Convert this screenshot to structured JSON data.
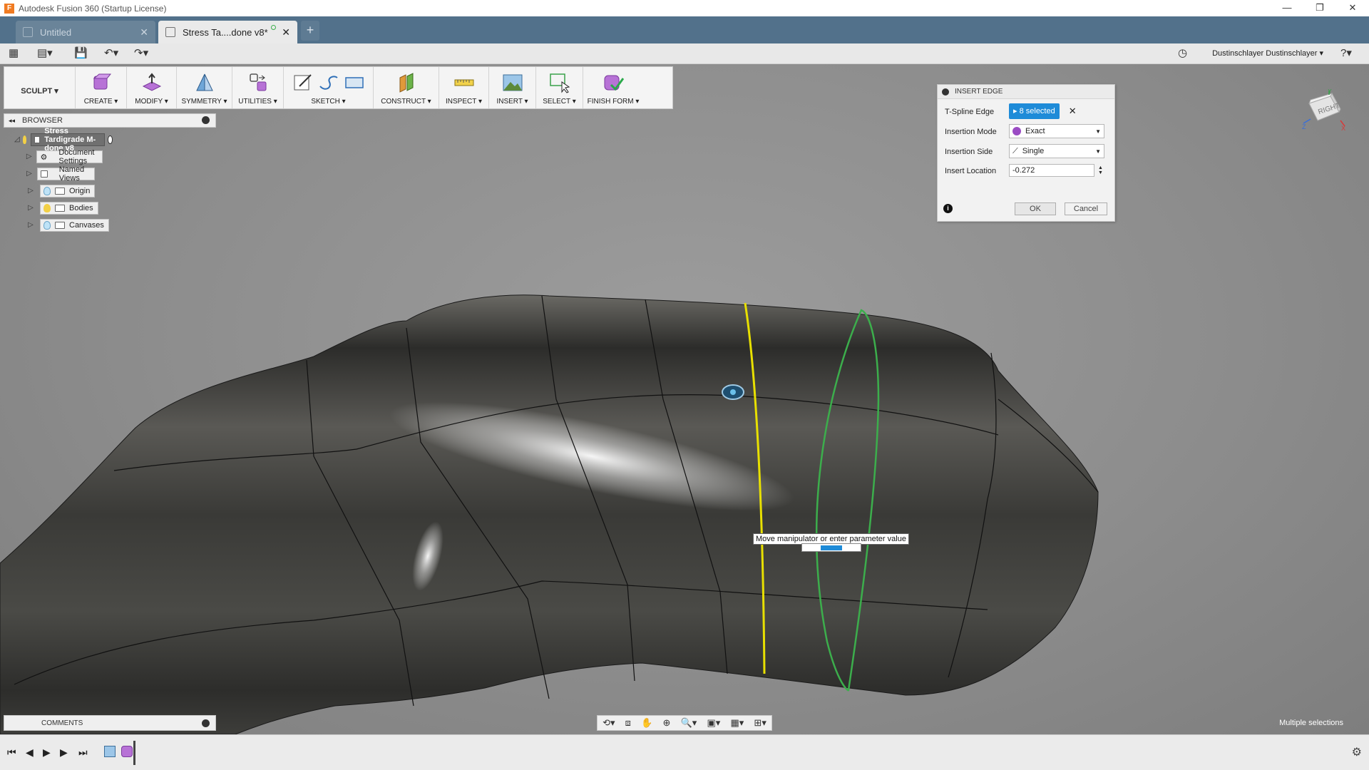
{
  "window": {
    "title": "Autodesk Fusion 360 (Startup License)",
    "controls": [
      "—",
      "❐",
      "✕"
    ]
  },
  "tabs": [
    {
      "label": "Untitled",
      "active": false
    },
    {
      "label": "Stress Ta....done v8*",
      "active": true
    }
  ],
  "quick_access": {
    "user": "Dustinschlayer Dustinschlayer ▾"
  },
  "toolbar": {
    "workspace": "SCULPT ▾",
    "groups": [
      "CREATE ▾",
      "MODIFY ▾",
      "SYMMETRY ▾",
      "UTILITIES ▾",
      "SKETCH ▾",
      "CONSTRUCT ▾",
      "INSPECT ▾",
      "INSERT ▾",
      "SELECT ▾",
      "FINISH FORM ▾"
    ]
  },
  "browser": {
    "title": "BROWSER",
    "root": "Stress Tardigrade M-done v8",
    "items": [
      "Document Settings",
      "Named Views",
      "Origin",
      "Bodies",
      "Canvases"
    ]
  },
  "dialog": {
    "title": "INSERT EDGE",
    "rows": [
      {
        "label": "T-Spline Edge",
        "value": "8 selected"
      },
      {
        "label": "Insertion Mode",
        "value": "Exact"
      },
      {
        "label": "Insertion Side",
        "value": "Single"
      },
      {
        "label": "Insert Location",
        "value": "-0.272"
      }
    ],
    "ok": "OK",
    "cancel": "Cancel"
  },
  "viewcube": {
    "face": "RIGHT"
  },
  "tooltip": "Move manipulator or enter parameter value",
  "comments": {
    "title": "COMMENTS"
  },
  "status": {
    "selection": "Multiple selections"
  },
  "colors": {
    "tabbar": "#52718b",
    "selection_blue": "#1e8bd8",
    "edge_yellow": "#e8e000",
    "edge_green": "#3cae4c"
  }
}
